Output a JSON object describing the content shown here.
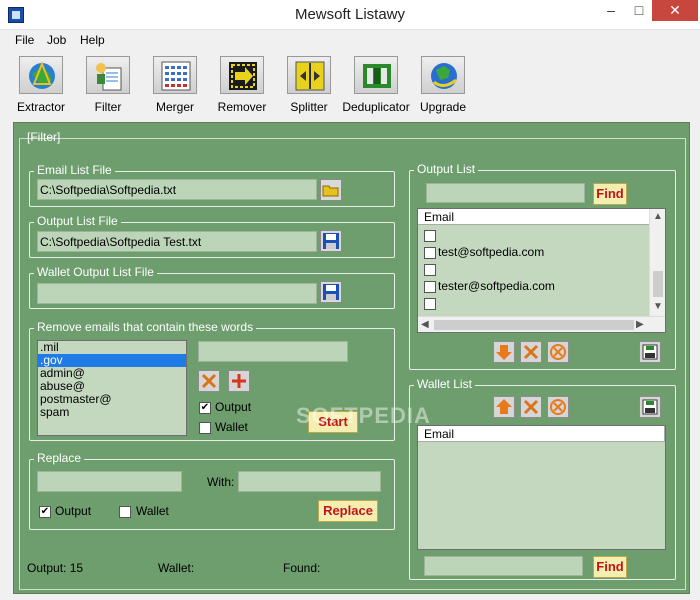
{
  "window": {
    "title": "Mewsoft Listawy"
  },
  "menu": [
    "File",
    "Job",
    "Help"
  ],
  "toolbar": [
    {
      "label": "Extractor",
      "icon": "extractor-icon"
    },
    {
      "label": "Filter",
      "icon": "filter-icon"
    },
    {
      "label": "Merger",
      "icon": "merger-icon"
    },
    {
      "label": "Remover",
      "icon": "remover-icon"
    },
    {
      "label": "Splitter",
      "icon": "splitter-icon"
    },
    {
      "label": "Deduplicator",
      "icon": "deduplicator-icon"
    },
    {
      "label": "Upgrade",
      "icon": "upgrade-icon"
    }
  ],
  "panel_title": "[Filter]",
  "email_list_file": {
    "label": "Email List File",
    "value": "C:\\Softpedia\\Softpedia.txt"
  },
  "output_list_file": {
    "label": "Output List File",
    "value": "C:\\Softpedia\\Softpedia Test.txt"
  },
  "wallet_output_file": {
    "label": "Wallet Output List File",
    "value": ""
  },
  "remove_words": {
    "label": "Remove emails that contain these words",
    "items": [
      ".mil",
      ".gov",
      "admin@",
      "abuse@",
      "postmaster@",
      "spam"
    ],
    "selected": ".gov",
    "input_value": "",
    "output_label": "Output",
    "output_checked": true,
    "wallet_label": "Wallet",
    "wallet_checked": false,
    "start_label": "Start"
  },
  "replace": {
    "label": "Replace",
    "with_label": "With:",
    "find_value": "",
    "with_value": "",
    "output_label": "Output",
    "output_checked": true,
    "wallet_label": "Wallet",
    "wallet_checked": false,
    "button_label": "Replace"
  },
  "output_list": {
    "label": "Output List",
    "find_label": "Find",
    "search_value": "",
    "column": "Email",
    "rows": [
      "",
      "test@softpedia.com",
      "",
      "tester@softpedia.com",
      ""
    ]
  },
  "wallet_list": {
    "label": "Wallet List",
    "find_label": "Find",
    "search_value": "",
    "column": "Email"
  },
  "status": {
    "output": "Output: 15",
    "wallet": "Wallet:",
    "found": "Found:"
  },
  "watermark": "SOFTPEDIA",
  "colors": {
    "panel_bg": "#6e9e6e",
    "field_bg": "#bcd4b8",
    "button_text": "#c0151b",
    "button_bg": "#f4eeb0"
  }
}
